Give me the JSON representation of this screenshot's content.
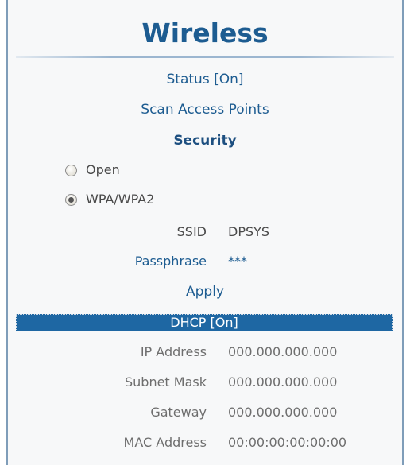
{
  "header": {
    "title": "Wireless"
  },
  "wireless": {
    "status_label": "Status [On]",
    "scan_label": "Scan Access Points"
  },
  "security": {
    "heading": "Security",
    "options": [
      {
        "label": "Open",
        "selected": false
      },
      {
        "label": "WPA/WPA2",
        "selected": true
      }
    ],
    "ssid_label": "SSID",
    "ssid_value": "DPSYS",
    "passphrase_label": "Passphrase",
    "passphrase_value": "***",
    "apply_label": "Apply"
  },
  "network": {
    "dhcp_label": "DHCP [On]",
    "ip_label": "IP Address",
    "ip_value": "000.000.000.000",
    "subnet_label": "Subnet Mask",
    "subnet_value": "000.000.000.000",
    "gateway_label": "Gateway",
    "gateway_value": "000.000.000.000",
    "mac_label": "MAC Address",
    "mac_value": "00:00:00:00:00:00"
  },
  "colors": {
    "accent": "#1d5c91",
    "highlight": "#1e67a3",
    "background": "#f7f8f9",
    "border": "#7f9db9"
  }
}
